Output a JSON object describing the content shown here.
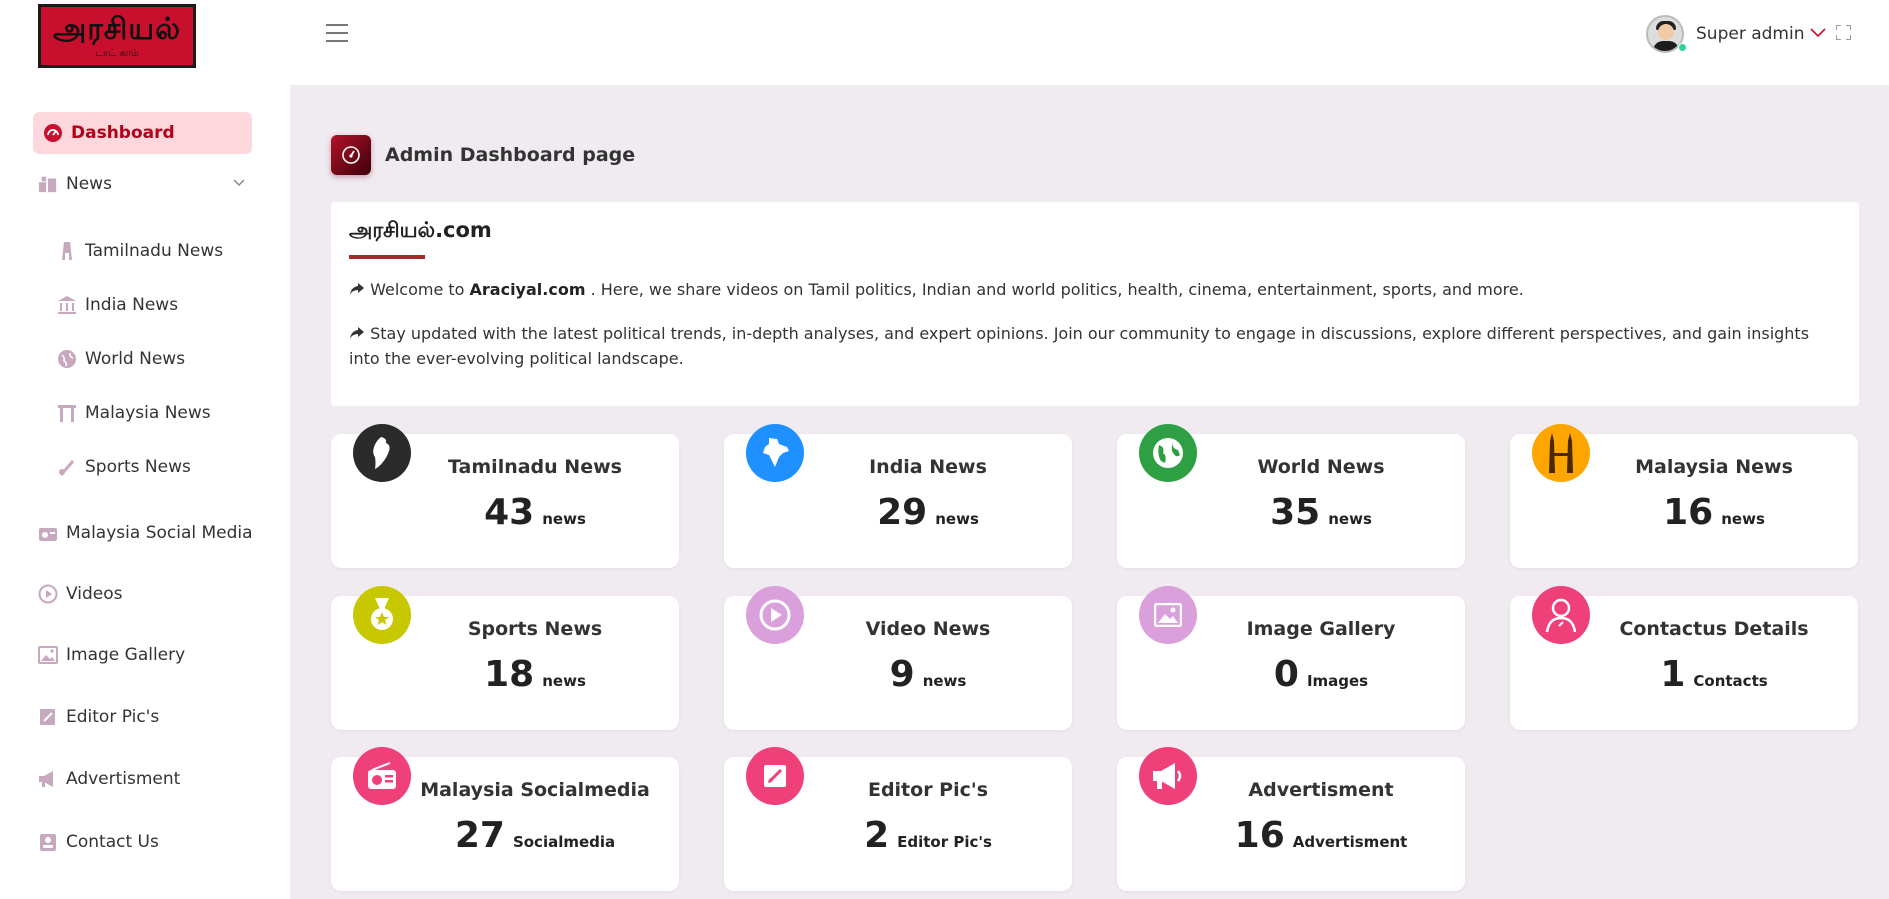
{
  "logo": {
    "main": "அரசியல்",
    "sub": "டாட் காம்"
  },
  "sidebar": {
    "dashboard": "Dashboard",
    "news": "News",
    "sub_items": [
      "Tamilnadu News",
      "India News",
      "World News",
      "Malaysia News",
      "Sports News"
    ],
    "items": [
      "Malaysia Social Media",
      "Videos",
      "Image Gallery",
      "Editor Pic's",
      "Advertisment",
      "Contact Us"
    ]
  },
  "topbar": {
    "username": "Super admin"
  },
  "page": {
    "title": "Admin Dashboard page"
  },
  "intro": {
    "title": "அரசியல்.com",
    "p1_prefix": "Welcome to ",
    "p1_brand": "Araciyal.com",
    "p1_suffix": " . Here, we share videos on Tamil politics, Indian and world politics, health, cinema, entertainment, sports, and more.",
    "p2": "Stay updated with the latest political trends, in-depth analyses, and expert opinions. Join our community to engage in discussions, explore different perspectives, and gain insights into the ever-evolving political landscape."
  },
  "stats": [
    {
      "title": "Tamilnadu News",
      "count": "43",
      "unit": "news",
      "color": "#2b2b2b"
    },
    {
      "title": "India News",
      "count": "29",
      "unit": "news",
      "color": "#1e90ff"
    },
    {
      "title": "World News",
      "count": "35",
      "unit": "news",
      "color": "#2ea043"
    },
    {
      "title": "Malaysia News",
      "count": "16",
      "unit": "news",
      "color": "#ffa500"
    },
    {
      "title": "Sports News",
      "count": "18",
      "unit": "news",
      "color": "#c8c800"
    },
    {
      "title": "Video News",
      "count": "9",
      "unit": "news",
      "color": "#d9a0dc"
    },
    {
      "title": "Image Gallery",
      "count": "0",
      "unit": "Images",
      "color": "#d9a0dc"
    },
    {
      "title": "Contactus Details",
      "count": "1",
      "unit": "Contacts",
      "color": "#f0407a"
    },
    {
      "title": "Malaysia Socialmedia",
      "count": "27",
      "unit": "Socialmedia",
      "color": "#f0407a"
    },
    {
      "title": "Editor Pic's",
      "count": "2",
      "unit": "Editor Pic's",
      "color": "#f0407a"
    },
    {
      "title": "Advertisment",
      "count": "16",
      "unit": "Advertisment",
      "color": "#f0407a"
    }
  ]
}
